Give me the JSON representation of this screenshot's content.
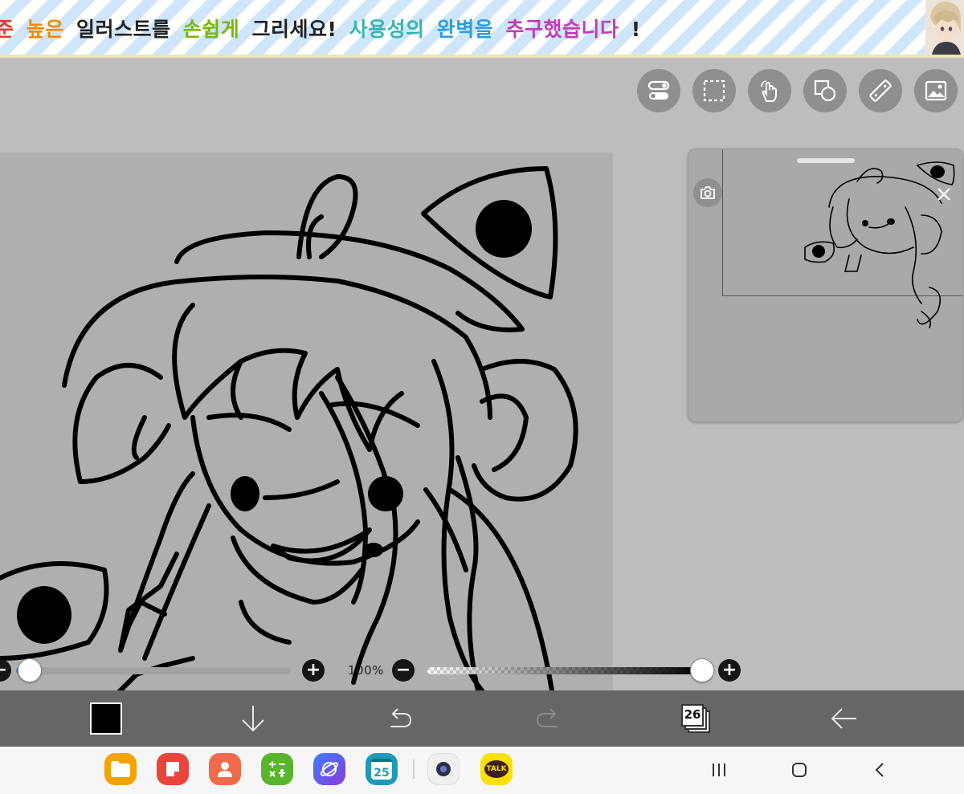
{
  "banner": {
    "segments": [
      {
        "text": "준",
        "color": "#e63b2e"
      },
      {
        "text": "높은",
        "color": "#f08a00"
      },
      {
        "text": "일러스트를",
        "color": "#222222"
      },
      {
        "text": "손쉽게",
        "color": "#7ab800"
      },
      {
        "text": "그리세요!",
        "color": "#222222"
      },
      {
        "text": "사용성의",
        "color": "#36b6b0"
      },
      {
        "text": "완벽을",
        "color": "#2a9ee0"
      },
      {
        "text": "추구했습니다",
        "color": "#c23bb8"
      },
      {
        "text": "!",
        "color": "#222222"
      }
    ]
  },
  "tools": [
    {
      "name": "toggle-icon"
    },
    {
      "name": "selection-icon"
    },
    {
      "name": "hand-tool-icon"
    },
    {
      "name": "shapes-icon"
    },
    {
      "name": "ruler-icon"
    },
    {
      "name": "image-icon"
    }
  ],
  "sliders": {
    "brush_size_fraction": 0.05,
    "opacity_label": "100%",
    "opacity_fraction": 1.0
  },
  "toolbar": {
    "current_color": "#000000",
    "layer_count": "26"
  },
  "dock": {
    "apps": [
      {
        "name": "files-app-icon",
        "color": "#f5a300"
      },
      {
        "name": "notes-app-icon",
        "color": "#e8453c"
      },
      {
        "name": "contacts-app-icon",
        "color": "#f26a4b"
      },
      {
        "name": "calculator-app-icon",
        "color": "#59b52b"
      },
      {
        "name": "internet-app-icon",
        "color": "#6b4fe0"
      },
      {
        "name": "calendar-app-icon",
        "color": "#1e9ab8"
      },
      {
        "name": "camera-app-icon",
        "color": "#f0f0f0"
      },
      {
        "name": "kakaotalk-app-icon",
        "color": "#fae100"
      }
    ],
    "calendar_date": "25",
    "kakao_label": "TALK"
  },
  "colors": {
    "canvas_bg": "#bdbdbd",
    "paper": "#afafaf",
    "toolbar": "#666666"
  }
}
